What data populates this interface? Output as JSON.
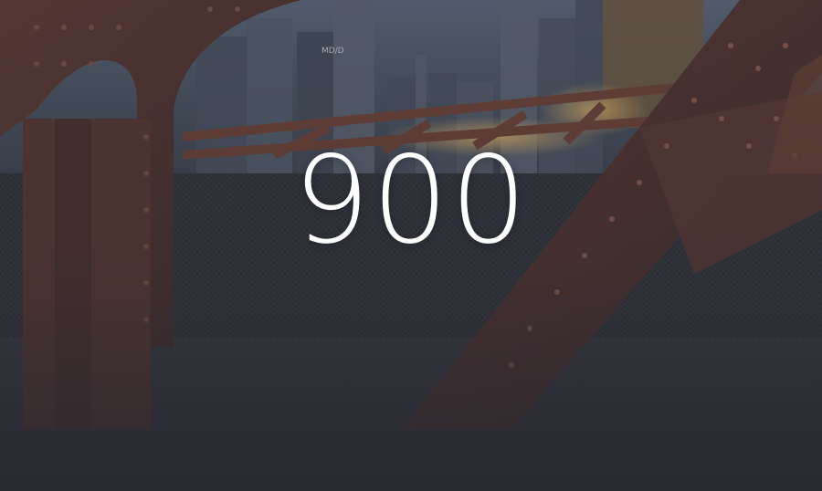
{
  "hero": {
    "headline": "900",
    "logo_text": "MD/D"
  }
}
